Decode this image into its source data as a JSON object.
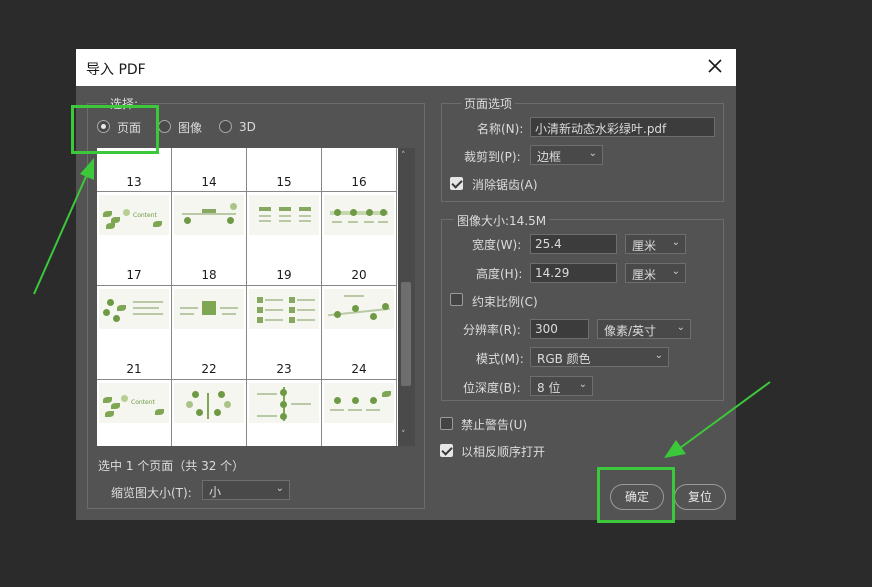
{
  "dialog": {
    "title": "导入 PDF"
  },
  "select_group": {
    "legend": "选择:",
    "options": [
      {
        "label": "页面",
        "selected": true
      },
      {
        "label": "图像",
        "selected": false
      },
      {
        "label": "3D",
        "selected": false
      }
    ],
    "pages": [
      {
        "num": "13"
      },
      {
        "num": "14"
      },
      {
        "num": "15"
      },
      {
        "num": "16"
      },
      {
        "num": "17"
      },
      {
        "num": "18"
      },
      {
        "num": "19"
      },
      {
        "num": "20"
      },
      {
        "num": "21"
      },
      {
        "num": "22"
      },
      {
        "num": "23"
      },
      {
        "num": "24"
      }
    ],
    "status": "选中 1 个页面（共 32 个）",
    "thumb_size_label": "缩览图大小(T):",
    "thumb_size_value": "小"
  },
  "page_options": {
    "legend": "页面选项",
    "name_label": "名称(N):",
    "name_value": "小清新动态水彩绿叶.pdf",
    "crop_label": "裁剪到(P):",
    "crop_value": "边框",
    "antialias_label": "消除锯齿(A)",
    "antialias_checked": true
  },
  "image_size": {
    "legend": "图像大小:14.5M",
    "width_label": "宽度(W):",
    "width_value": "25.4",
    "width_unit": "厘米",
    "height_label": "高度(H):",
    "height_value": "14.29",
    "height_unit": "厘米",
    "constrain_label": "约束比例(C)",
    "constrain_checked": false,
    "resolution_label": "分辨率(R):",
    "resolution_value": "300",
    "resolution_unit": "像素/英寸",
    "mode_label": "模式(M):",
    "mode_value": "RGB 颜色",
    "depth_label": "位深度(B):",
    "depth_value": "8 位"
  },
  "options": {
    "suppress_warnings_label": "禁止警告(U)",
    "suppress_warnings_checked": false,
    "reverse_order_label": "以相反顺序打开",
    "reverse_order_checked": true
  },
  "buttons": {
    "ok": "确定",
    "reset": "复位"
  },
  "colors": {
    "highlight": "#3bc93b",
    "dialog_bg": "#535353",
    "backdrop": "#2b2b2b"
  }
}
